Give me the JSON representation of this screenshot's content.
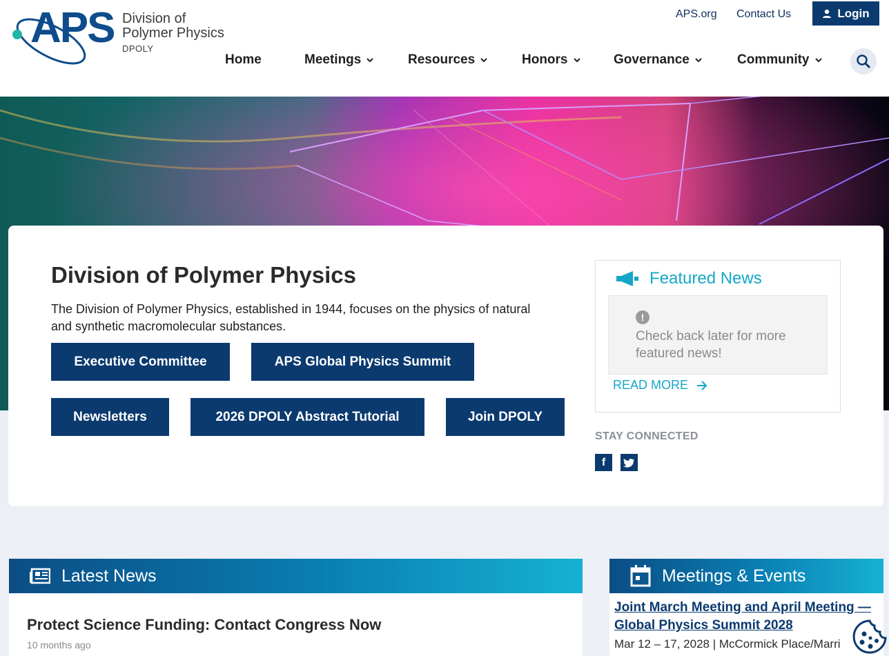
{
  "header": {
    "logo": {
      "mark": "APS",
      "line1": "Division of",
      "line2": "Polymer Physics",
      "sub": "DPOLY"
    },
    "utility_links": [
      "APS.org",
      "Contact Us"
    ],
    "login_label": "Login",
    "nav": [
      {
        "label": "Home",
        "dropdown": false
      },
      {
        "label": "Meetings",
        "dropdown": true
      },
      {
        "label": "Resources",
        "dropdown": true
      },
      {
        "label": "Honors",
        "dropdown": true
      },
      {
        "label": "Governance",
        "dropdown": true
      },
      {
        "label": "Community",
        "dropdown": true
      }
    ],
    "search_icon": "search-icon"
  },
  "hero_card": {
    "title": "Division of Polymer Physics",
    "description": "The Division of Polymer Physics, established in 1944, focuses on the physics of natural and synthetic macromolecular substances.",
    "buttons": [
      "Executive Committee",
      "APS Global Physics Summit",
      "Newsletters",
      "2026 DPOLY Abstract Tutorial",
      "Join DPOLY"
    ]
  },
  "featured_news": {
    "icon": "megaphone-icon",
    "title": "Featured News",
    "empty_icon": "alert-icon",
    "empty_message": "Check back later for more featured news!",
    "read_more": "READ MORE"
  },
  "stay_connected": {
    "label": "STAY CONNECTED",
    "icons": [
      "facebook-icon",
      "twitter-icon"
    ]
  },
  "latest_news": {
    "icon": "newspaper-icon",
    "title": "Latest News",
    "items": [
      {
        "title": "Protect Science Funding: Contact Congress Now",
        "time": "10 months ago"
      }
    ]
  },
  "meetings_events": {
    "icon": "calendar-icon",
    "title": "Meetings & Events",
    "items": [
      {
        "title": "Joint March Meeting and April Meeting — Global Physics Summit 2028",
        "meta": "Mar 12 – 17, 2028 | McCormick Place/Marri"
      }
    ]
  },
  "colors": {
    "navy": "#0b3a6f",
    "teal": "#14a7c7",
    "page_bg": "#eceff5"
  }
}
